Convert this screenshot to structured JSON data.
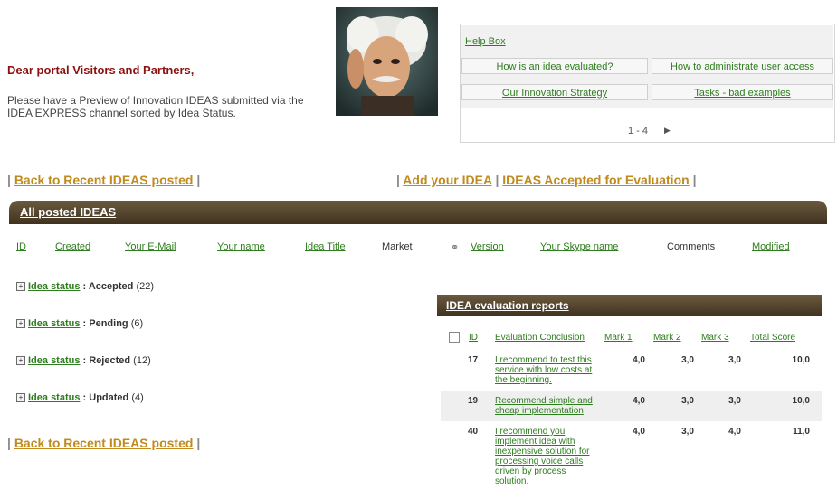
{
  "intro": {
    "greeting": "Dear portal Visitors and Partners,",
    "text": "Please have a Preview of Innovation IDEAS submitted via the IDEA EXPRESS channel sorted by Idea Status."
  },
  "help_box": {
    "title": "Help Box",
    "links": [
      "How is an idea evaluated?",
      "How to administrate user access",
      "Our Innovation Strategy",
      "Tasks - bad examples"
    ],
    "pager": "1 - 4"
  },
  "nav": {
    "back_recent": "Back to Recent IDEAS posted",
    "add_idea": "Add your IDEA",
    "accepted_eval": "IDEAS Accepted for Evaluation",
    "sep": "|"
  },
  "list": {
    "title": "All posted IDEAS",
    "columns": [
      "ID",
      "Created",
      "Your E-Mail",
      "Your name",
      "Idea Title",
      "Market",
      "Version",
      "Your Skype name",
      "Comments",
      "Modified"
    ],
    "groups": [
      {
        "label": "Idea status",
        "value": "Accepted",
        "count": "(22)"
      },
      {
        "label": "Idea status",
        "value": "Pending",
        "count": "(6)"
      },
      {
        "label": "Idea status",
        "value": "Rejected",
        "count": "(12)"
      },
      {
        "label": "Idea status",
        "value": "Updated",
        "count": "(4)"
      }
    ]
  },
  "evaluation": {
    "title": "IDEA evaluation reports",
    "columns": [
      "ID",
      "Evaluation Conclusion",
      "Mark 1",
      "Mark 2",
      "Mark 3",
      "Total Score"
    ],
    "rows": [
      {
        "id": "17",
        "conclusion": "I recommend to test this service with low costs at the beginning.",
        "m1": "4,0",
        "m2": "3,0",
        "m3": "3,0",
        "total": "10,0"
      },
      {
        "id": "19",
        "conclusion": "Recommend simple and cheap implementation",
        "m1": "4,0",
        "m2": "3,0",
        "m3": "3,0",
        "total": "10,0"
      },
      {
        "id": "40",
        "conclusion": "I recommend you implement idea with inexpensive solution for processing voice calls driven by process solution.",
        "m1": "4,0",
        "m2": "3,0",
        "m3": "4,0",
        "total": "11,0"
      }
    ]
  },
  "colors": {
    "accent_bar": "#4a3b25",
    "greeting": "#8b1010",
    "link": "#2e7d1e",
    "nav_link": "#c08a1e"
  }
}
